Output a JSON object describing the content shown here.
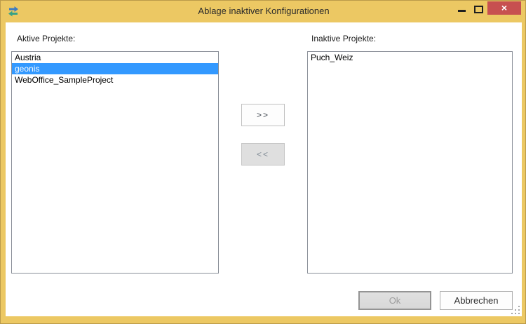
{
  "window": {
    "title": "Ablage inaktiver Konfigurationen",
    "close_glyph": "×",
    "colors": {
      "titlebar_gold": "#ecc863",
      "close_red": "#c75050",
      "selection_blue": "#3399ff",
      "client_bg": "#ffffff"
    }
  },
  "active_list": {
    "label": "Aktive Projekte:",
    "items": [
      {
        "label": "Austria",
        "selected": false
      },
      {
        "label": "geonis",
        "selected": true
      },
      {
        "label": "WebOffice_SampleProject",
        "selected": false
      }
    ]
  },
  "inactive_list": {
    "label": "Inaktive Projekte:",
    "items": [
      {
        "label": "Puch_Weiz",
        "selected": false
      }
    ]
  },
  "transfer": {
    "move_right_label": ">>",
    "move_left_label": "<<"
  },
  "footer": {
    "ok_label": "Ok",
    "cancel_label": "Abbrechen"
  }
}
